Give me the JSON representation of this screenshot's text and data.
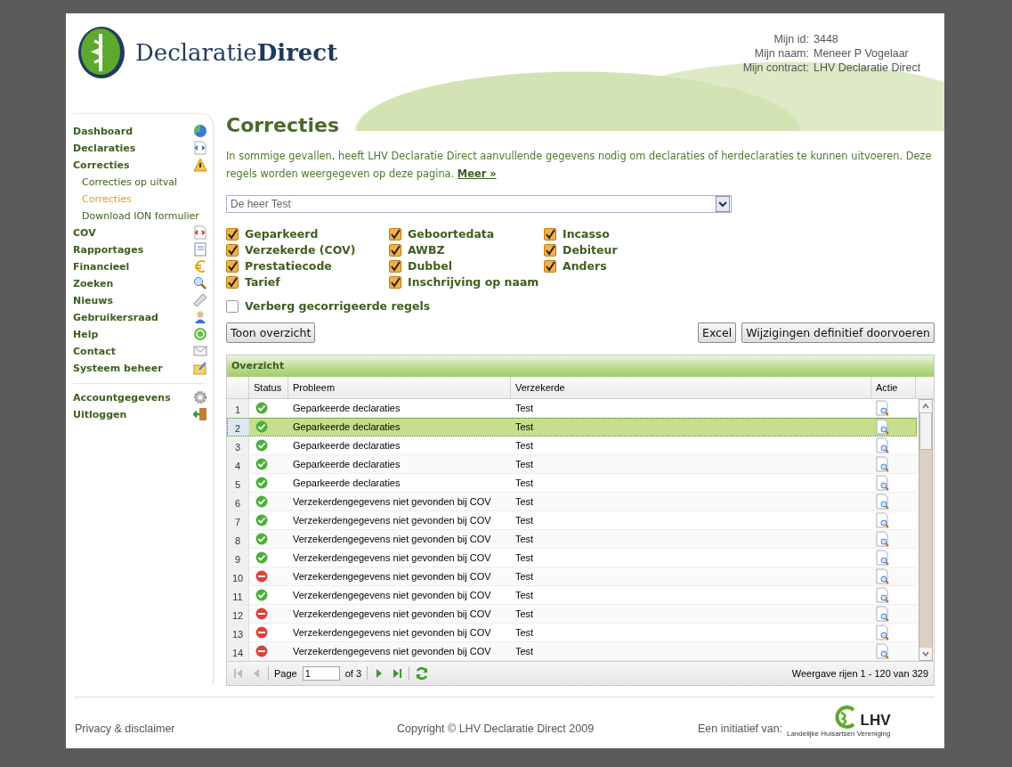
{
  "header": {
    "logo": "Declaratie**Direct**",
    "user_info": [
      {
        "label": "Mijn id:",
        "value": "3448"
      },
      {
        "label": "Mijn naam:",
        "value": "Meneer P Vogelaar"
      },
      {
        "label": "Mijn contract:",
        "value": "LHV Declaratie Direct"
      }
    ]
  },
  "sidebar": {
    "items": [
      {
        "label": "Dashboard",
        "kind": "main",
        "selected": false
      },
      {
        "label": "Declaraties",
        "kind": "main",
        "selected": false
      },
      {
        "label": "Correcties",
        "kind": "main",
        "selected": false
      },
      {
        "label": "Correcties op uitval",
        "kind": "sub",
        "selected": false
      },
      {
        "label": "Correcties",
        "kind": "sub",
        "selected": true
      },
      {
        "label": "Download ION formulier",
        "kind": "sub",
        "selected": false
      },
      {
        "label": "COV",
        "kind": "main",
        "selected": false
      },
      {
        "label": "Rapportages",
        "kind": "main",
        "selected": false
      },
      {
        "label": "Financieel",
        "kind": "main",
        "selected": false
      },
      {
        "label": "Zoeken",
        "kind": "main",
        "selected": false
      },
      {
        "label": "Nieuws",
        "kind": "main",
        "selected": false
      },
      {
        "label": "Gebruikersraad",
        "kind": "main",
        "selected": false
      },
      {
        "label": "Help",
        "kind": "main",
        "selected": false
      },
      {
        "label": "Contact",
        "kind": "main",
        "selected": false
      },
      {
        "label": "Systeem beheer",
        "kind": "main",
        "selected": false
      }
    ],
    "account_items": [
      {
        "label": "Accountgegevens"
      },
      {
        "label": "Uitloggen"
      }
    ]
  },
  "page": {
    "title": "Correcties",
    "intro": "In sommige gevallen, heeft LHV Declaratie Direct aanvullende gegevens nodig om declaraties of herdeclaraties te kunnen uitvoeren. Deze regels worden weergegeven op deze pagina.",
    "more_link": "Meer »",
    "person_select": "De heer Test",
    "filters": [
      {
        "label": "Geparkeerd",
        "checked": true
      },
      {
        "label": "Verzekerde (COV)",
        "checked": true
      },
      {
        "label": "Prestatiecode",
        "checked": true
      },
      {
        "label": "Tarief",
        "checked": true
      },
      {
        "label": "Geboortedata",
        "checked": true
      },
      {
        "label": "AWBZ",
        "checked": true
      },
      {
        "label": "Dubbel",
        "checked": true
      },
      {
        "label": "Inschrijving op naam",
        "checked": true
      },
      {
        "label": "Incasso",
        "checked": true
      },
      {
        "label": "Debiteur",
        "checked": true
      },
      {
        "label": "Anders",
        "checked": true
      }
    ],
    "hide_corrected": {
      "label": "Verberg gecorrigeerde regels",
      "checked": false
    },
    "buttons_left": [
      "Toon overzicht"
    ],
    "buttons_right": [
      "Excel",
      "Wijzigingen definitief doorvoeren"
    ]
  },
  "table": {
    "title": "Overzicht",
    "columns": [
      "Status",
      "Probleem",
      "Verzekerde",
      "Actie"
    ],
    "rows": [
      {
        "num": "1",
        "kind": "ok",
        "problem": "Geparkeerde declaraties",
        "insured": "Test",
        "selected": false
      },
      {
        "num": "2",
        "kind": "ok",
        "problem": "Geparkeerde declaraties",
        "insured": "Test",
        "selected": true
      },
      {
        "num": "3",
        "kind": "ok",
        "problem": "Geparkeerde declaraties",
        "insured": "Test",
        "selected": false
      },
      {
        "num": "4",
        "kind": "ok",
        "problem": "Geparkeerde declaraties",
        "insured": "Test",
        "selected": false
      },
      {
        "num": "5",
        "kind": "ok",
        "problem": "Geparkeerde declaraties",
        "insured": "Test",
        "selected": false
      },
      {
        "num": "6",
        "kind": "ok",
        "problem": "Verzekerdengegevens niet gevonden bij COV",
        "insured": "Test",
        "selected": false
      },
      {
        "num": "7",
        "kind": "ok",
        "problem": "Verzekerdengegevens niet gevonden bij COV",
        "insured": "Test",
        "selected": false
      },
      {
        "num": "8",
        "kind": "ok",
        "problem": "Verzekerdengegevens niet gevonden bij COV",
        "insured": "Test",
        "selected": false
      },
      {
        "num": "9",
        "kind": "ok",
        "problem": "Verzekerdengegevens niet gevonden bij COV",
        "insured": "Test",
        "selected": false
      },
      {
        "num": "10",
        "kind": "error",
        "problem": "Verzekerdengegevens niet gevonden bij COV",
        "insured": "Test",
        "selected": false
      },
      {
        "num": "11",
        "kind": "ok",
        "problem": "Verzekerdengegevens niet gevonden bij COV",
        "insured": "Test",
        "selected": false
      },
      {
        "num": "12",
        "kind": "error",
        "problem": "Verzekerdengegevens niet gevonden bij COV",
        "insured": "Test",
        "selected": false
      },
      {
        "num": "13",
        "kind": "error",
        "problem": "Verzekerdengegevens niet gevonden bij COV",
        "insured": "Test",
        "selected": false
      },
      {
        "num": "14",
        "kind": "error",
        "problem": "Verzekerdengegevens niet gevonden bij COV",
        "insured": "Test",
        "selected": false
      }
    ],
    "pager": {
      "page_label": "Page",
      "page_value": "1",
      "of_label": "of 3",
      "summary": "Weergave rijen 1 - 120 van 329"
    }
  },
  "footer": {
    "privacy": "Privacy & disclaimer",
    "copyright": "Copyright © LHV Declaratie Direct 2009",
    "initiative": "Een initiatief van:",
    "lhv_logo": "LHV",
    "lhv_tagline": "Landelijke Huisartsen Vereniging"
  }
}
